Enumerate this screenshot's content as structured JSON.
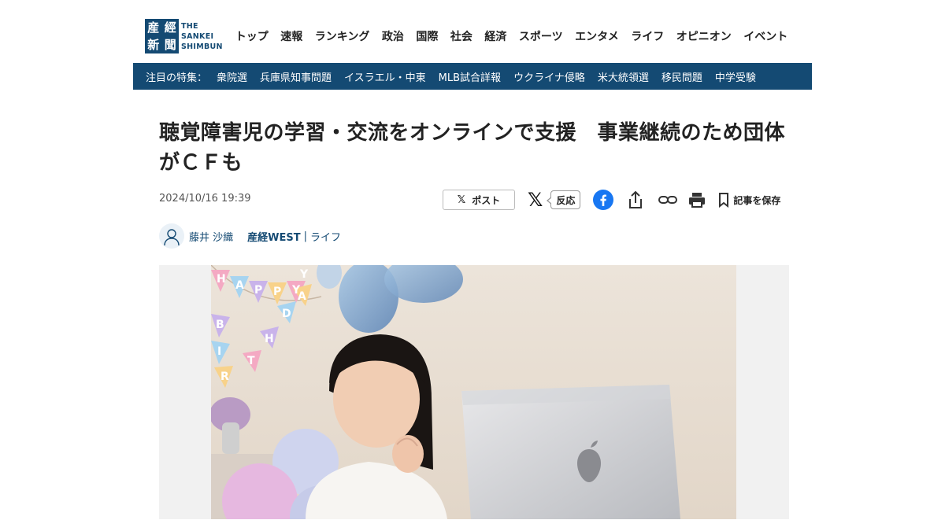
{
  "site": {
    "logo_seal_chars": [
      "産",
      "經",
      "新",
      "聞"
    ],
    "logo_text_lines": [
      "THE",
      "SANKEI",
      "SHIMBUN"
    ],
    "brand_color": "#144a73"
  },
  "nav": {
    "items": [
      "トップ",
      "速報",
      "ランキング",
      "政治",
      "国際",
      "社会",
      "経済",
      "スポーツ",
      "エンタメ",
      "ライフ",
      "オピニオン",
      "イベント"
    ]
  },
  "topics": {
    "label": "注目の特集：",
    "items": [
      "衆院選",
      "兵庫県知事問題",
      "イスラエル・中東",
      "MLB試合詳報",
      "ウクライナ侵略",
      "米大統領選",
      "移民問題",
      "中学受験"
    ]
  },
  "article": {
    "headline": "聴覚障害児の学習・交流をオンラインで支援　事業継続のため団体がＣＦも",
    "date": "2024/10/16 19:39",
    "author": "藤井 沙織",
    "source": "産経WEST",
    "separator": "|",
    "category": "ライフ"
  },
  "share": {
    "post_label": "ポスト",
    "reaction_label": "反応",
    "save_label": "記事を保存",
    "icons": [
      "x-icon",
      "facebook-icon",
      "share-icon",
      "link-icon",
      "print-icon",
      "bookmark-icon"
    ]
  },
  "photo": {
    "banner_letters": [
      "H",
      "A",
      "P",
      "P",
      "Y",
      "B",
      "I",
      "R",
      "T",
      "H",
      "D",
      "A",
      "Y"
    ]
  }
}
